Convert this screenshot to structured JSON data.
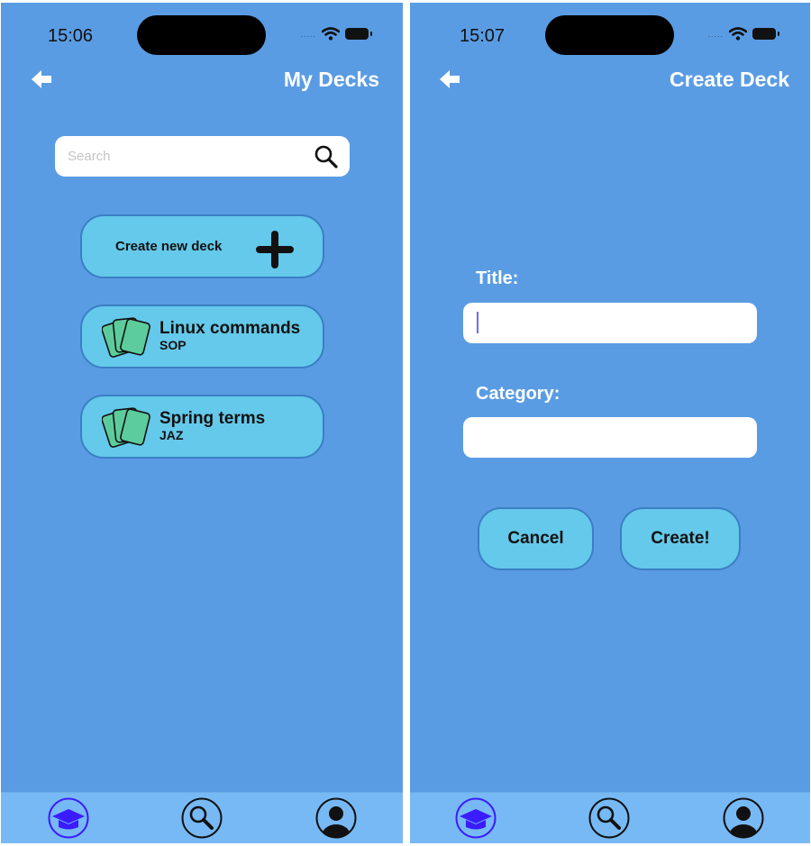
{
  "left": {
    "status_time": "15:06",
    "title": "My Decks",
    "search": {
      "placeholder": "Search",
      "value": ""
    },
    "create_label": "Create new deck",
    "decks": [
      {
        "title": "Linux commands",
        "category": "SOP"
      },
      {
        "title": "Spring terms",
        "category": "JAZ"
      }
    ]
  },
  "right": {
    "status_time": "15:07",
    "title": "Create Deck",
    "fields": {
      "title_label": "Title:",
      "title_value": "",
      "category_label": "Category:",
      "category_value": ""
    },
    "buttons": {
      "cancel": "Cancel",
      "create": "Create!"
    }
  },
  "signal_dots": ".....",
  "tabs": [
    {
      "icon": "graduation-cap-icon",
      "active": true
    },
    {
      "icon": "search-icon",
      "active": false
    },
    {
      "icon": "profile-icon",
      "active": false
    }
  ],
  "colors": {
    "background": "#5a9ce3",
    "pill": "#64c9ea",
    "tab_bar": "#77b9f4",
    "active_tab": "#3b1cff",
    "card_green": "#5ccc9c"
  }
}
